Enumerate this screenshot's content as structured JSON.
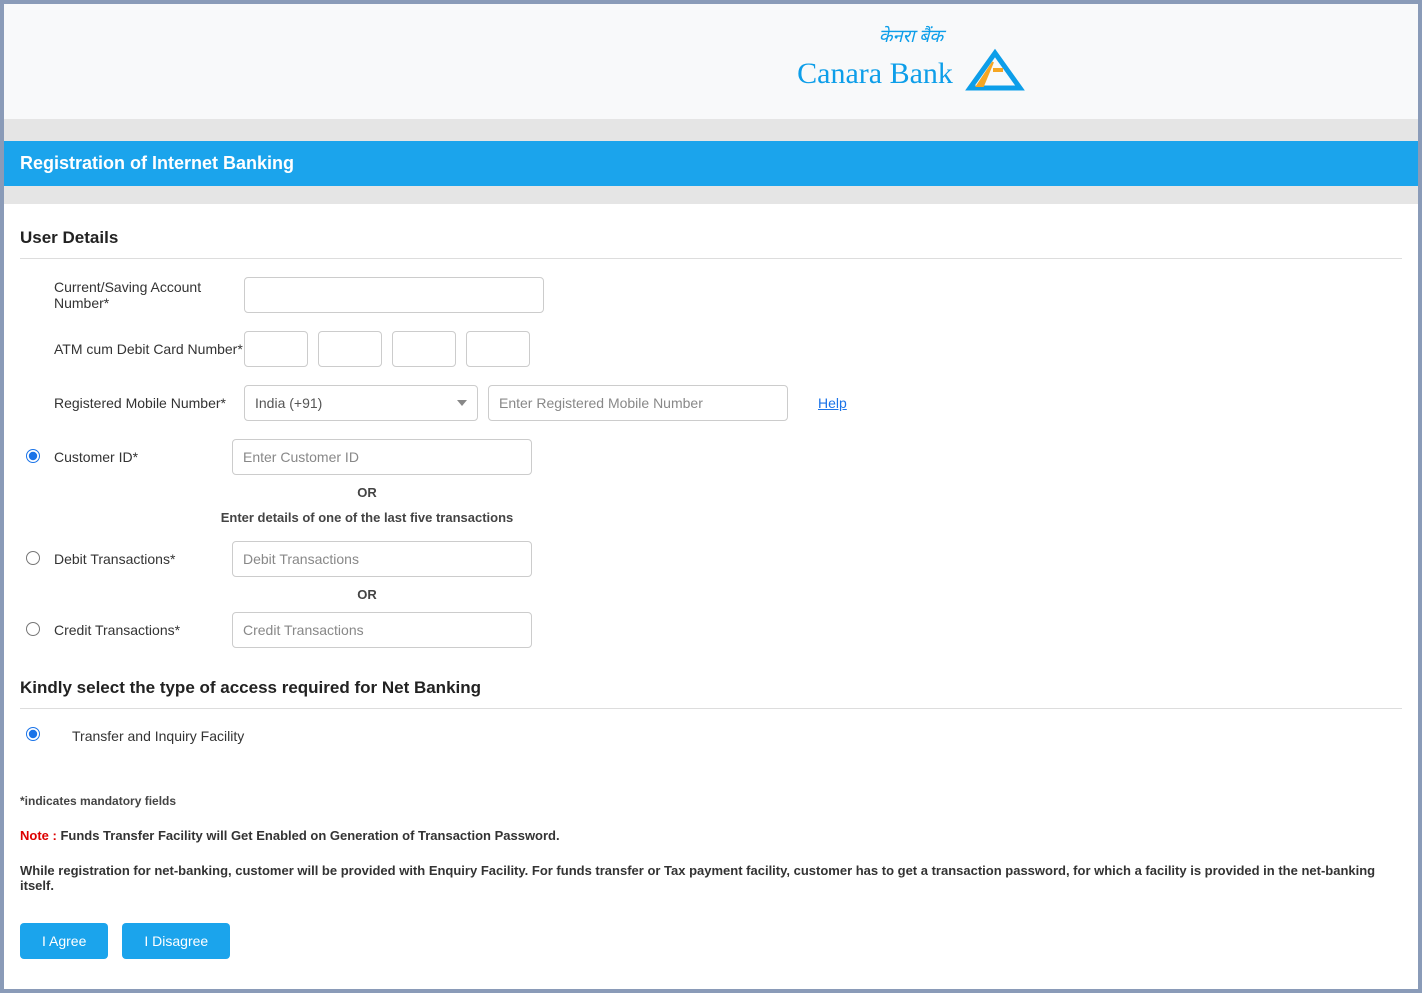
{
  "logo": {
    "hindi": "केनरा बैंक",
    "english": "Canara Bank"
  },
  "page_title": "Registration of Internet Banking",
  "section1_heading": "User Details",
  "labels": {
    "account_number": "Current/Saving Account Number*",
    "debit_card": "ATM cum Debit Card Number*",
    "mobile": "Registered Mobile Number*",
    "customer_id": "Customer ID*",
    "debit_txn": "Debit Transactions*",
    "credit_txn": "Credit Transactions*"
  },
  "placeholders": {
    "mobile": "Enter Registered Mobile Number",
    "customer_id": "Enter Customer ID",
    "debit_txn": "Debit Transactions",
    "credit_txn": "Credit Transactions"
  },
  "country_selected": "India (+91)",
  "help_link": "Help",
  "or_text": "OR",
  "instruction_text": "Enter details of one of the last five transactions",
  "section2_heading": "Kindly select the type of access required for Net Banking",
  "access_option": "Transfer and Inquiry Facility",
  "mandatory_note": "*indicates mandatory fields",
  "note_prefix": "Note : ",
  "note_body": "Funds Transfer Facility will Get Enabled on Generation of Transaction Password.",
  "info_text": "While registration for net-banking, customer will be provided with Enquiry Facility. For funds transfer or Tax payment facility, customer has to get a transaction password, for which a facility is provided in the net-banking itself.",
  "buttons": {
    "agree": "I Agree",
    "disagree": "I Disagree"
  }
}
